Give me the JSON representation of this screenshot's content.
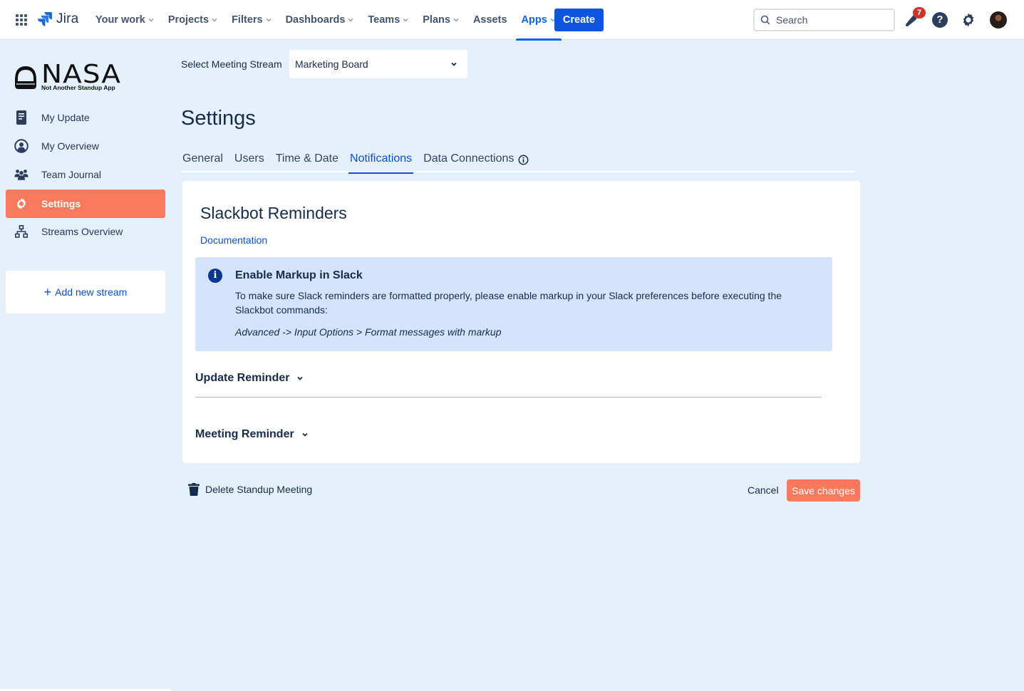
{
  "topnav": {
    "product_name": "Jira",
    "items": [
      {
        "label": "Your work",
        "has_dropdown": true
      },
      {
        "label": "Projects",
        "has_dropdown": true
      },
      {
        "label": "Filters",
        "has_dropdown": true
      },
      {
        "label": "Dashboards",
        "has_dropdown": true
      },
      {
        "label": "Teams",
        "has_dropdown": true
      },
      {
        "label": "Plans",
        "has_dropdown": true
      },
      {
        "label": "Assets",
        "has_dropdown": false
      },
      {
        "label": "Apps",
        "has_dropdown": true,
        "active": true
      }
    ],
    "create_label": "Create",
    "search_placeholder": "Search",
    "notification_count": "7",
    "help_glyph": "?"
  },
  "sidebar": {
    "brand": "NASA",
    "tagline": "Not Another Standup App",
    "items": [
      {
        "label": "My Update",
        "icon": "document-icon"
      },
      {
        "label": "My Overview",
        "icon": "user-circle-icon"
      },
      {
        "label": "Team Journal",
        "icon": "people-icon"
      },
      {
        "label": "Settings",
        "icon": "gear-icon",
        "active": true
      },
      {
        "label": "Streams Overview",
        "icon": "hierarchy-icon"
      }
    ],
    "add_stream_label": "Add new stream"
  },
  "main": {
    "stream_select_label": "Select Meeting Stream",
    "stream_selected": "Marketing Board",
    "page_title": "Settings",
    "tabs": [
      {
        "label": "General"
      },
      {
        "label": "Users"
      },
      {
        "label": "Time & Date"
      },
      {
        "label": "Notifications",
        "active": true
      },
      {
        "label": "Data Connections",
        "has_info": true
      }
    ],
    "card": {
      "title": "Slackbot Reminders",
      "doc_link": "Documentation",
      "info": {
        "title": "Enable Markup in Slack",
        "body": "To make sure Slack reminders are formatted properly, please enable markup in your Slack preferences before executing the Slackbot commands:",
        "path": "Advanced -> Input Options > Format messages with markup"
      },
      "sections": [
        {
          "label": "Update Reminder"
        },
        {
          "label": "Meeting Reminder"
        }
      ]
    },
    "delete_label": "Delete Standup Meeting",
    "cancel_label": "Cancel",
    "save_label": "Save changes"
  },
  "colors": {
    "accent": "#f87a5e",
    "jira_blue": "#0c66e4",
    "link_blue": "#0c4fcc",
    "page_bg": "#e4f0fc",
    "info_bg": "#d3e4fc"
  }
}
